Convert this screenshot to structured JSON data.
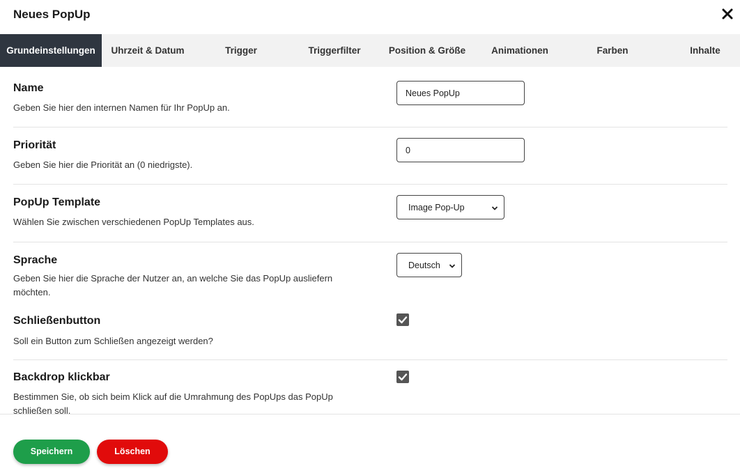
{
  "dialog": {
    "title": "Neues PopUp"
  },
  "tabs": [
    {
      "label": "Grundeinstellungen"
    },
    {
      "label": "Uhrzeit & Datum"
    },
    {
      "label": "Trigger"
    },
    {
      "label": "Triggerfilter"
    },
    {
      "label": "Position & Größe"
    },
    {
      "label": "Animationen"
    },
    {
      "label": "Farben"
    },
    {
      "label": "Inhalte"
    }
  ],
  "fields": {
    "name": {
      "label": "Name",
      "description": "Geben Sie hier den internen Namen für Ihr PopUp an.",
      "value": "Neues PopUp"
    },
    "priority": {
      "label": "Priorität",
      "description": "Geben Sie hier die Priorität an (0 niedrigste).",
      "value": "0"
    },
    "template": {
      "label": "PopUp Template",
      "description": "Wählen Sie zwischen verschiedenen PopUp Templates aus.",
      "value": "Image Pop-Up"
    },
    "language": {
      "label": "Sprache",
      "description": "Geben Sie hier die Sprache der Nutzer an, an welche Sie das PopUp ausliefern möchten.",
      "value": "Deutsch"
    },
    "close_button": {
      "label": "Schließenbutton",
      "description": "Soll ein Button zum Schließen angezeigt werden?",
      "checked": true
    },
    "backdrop": {
      "label": "Backdrop klickbar",
      "description": "Bestimmen Sie, ob sich beim Klick auf die Umrahmung des PopUps das PopUp schließen soll.",
      "checked": true
    }
  },
  "footer": {
    "save_label": "Speichern",
    "delete_label": "Löschen"
  },
  "colors": {
    "active_tab": "#2f3640",
    "save": "#1e9e4a",
    "delete": "#e10b0b"
  }
}
